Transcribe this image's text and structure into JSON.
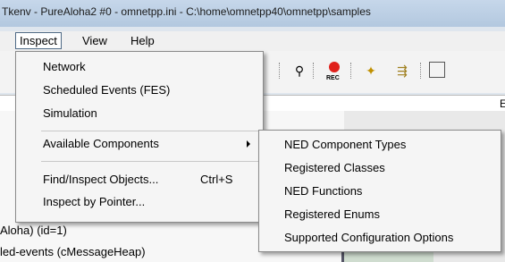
{
  "window": {
    "title": "Tkenv - PureAloha2 #0 - omnetpp.ini - C:\\home\\omnetpp40\\omnetpp\\samples"
  },
  "menubar": {
    "items": [
      "Inspect",
      "View",
      "Help"
    ]
  },
  "inspect_menu": {
    "items": [
      {
        "label": "Network"
      },
      {
        "label": "Scheduled Events (FES)"
      },
      {
        "label": "Simulation"
      },
      {
        "label": "Available Components",
        "submenu": true
      },
      {
        "label": "Find/Inspect Objects...",
        "shortcut": "Ctrl+S"
      },
      {
        "label": "Inspect by Pointer..."
      }
    ]
  },
  "components_submenu": {
    "items": [
      "NED Component Types",
      "Registered Classes",
      "NED Functions",
      "Registered Enums",
      "Supported Configuration Options"
    ]
  },
  "toolbar": {
    "rec_label": "REC"
  },
  "entry": {
    "right_char": "E"
  },
  "tree": {
    "line1": "Aloha) (id=1)",
    "line2": "led-events (cMessageHeap)"
  },
  "colors": {
    "menu_bg": "#f5f5f5",
    "titlebar": "#c6d7ea"
  }
}
